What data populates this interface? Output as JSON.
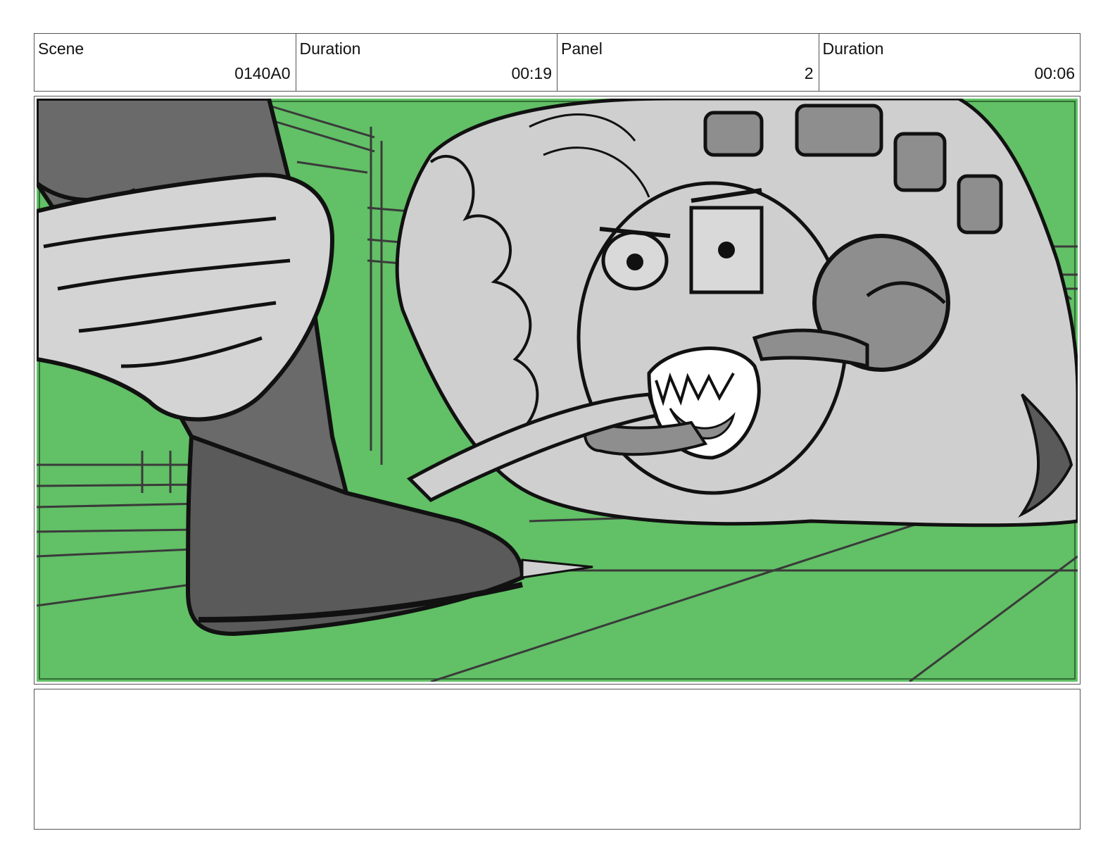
{
  "header": {
    "cells": [
      {
        "label": "Scene",
        "value": "0140A0"
      },
      {
        "label": "Duration",
        "value": "00:19"
      },
      {
        "label": "Panel",
        "value": "2"
      },
      {
        "label": "Duration",
        "value": "00:06"
      }
    ]
  },
  "panel": {
    "background_color": "#62c066",
    "line_color": "#111111",
    "gray_light": "#cfcfcf",
    "gray_mid": "#8e8e8e",
    "gray_dark": "#5a5a5a"
  },
  "notes": {
    "text": ""
  }
}
